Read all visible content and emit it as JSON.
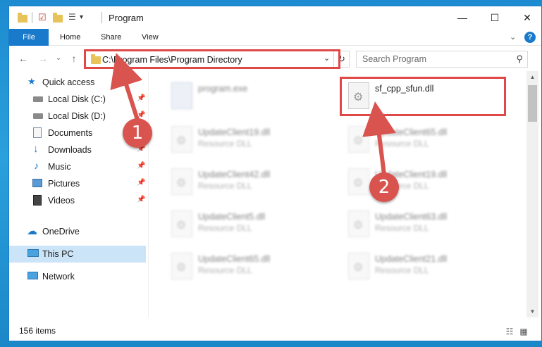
{
  "window": {
    "title": "Program",
    "controls": {
      "minimize": "—",
      "maximize": "☐",
      "close": "✕"
    }
  },
  "ribbon": {
    "tabs": [
      "File",
      "Home",
      "Share",
      "View"
    ],
    "expand": "⌄",
    "help": "?"
  },
  "address": {
    "path": "C:\\Program Files\\Program Directory",
    "refresh": "↻",
    "dropdown": "⌄"
  },
  "search": {
    "placeholder": "Search Program",
    "icon": "⚲"
  },
  "nav": {
    "back": "←",
    "forward": "→",
    "recent": "⌄",
    "up": "↑"
  },
  "sidebar": {
    "items": [
      {
        "label": "Quick access",
        "icon": "star-icon",
        "pinned": false
      },
      {
        "label": "Local Disk (C:)",
        "icon": "drive-icon",
        "pinned": true
      },
      {
        "label": "Local Disk (D:)",
        "icon": "drive-icon",
        "pinned": true
      },
      {
        "label": "Documents",
        "icon": "documents-icon",
        "pinned": true
      },
      {
        "label": "Downloads",
        "icon": "download-icon",
        "pinned": true
      },
      {
        "label": "Music",
        "icon": "music-icon",
        "pinned": true
      },
      {
        "label": "Pictures",
        "icon": "pictures-icon",
        "pinned": true
      },
      {
        "label": "Videos",
        "icon": "videos-icon",
        "pinned": true
      },
      {
        "label": "OneDrive",
        "icon": "cloud-icon",
        "pinned": false
      },
      {
        "label": "This PC",
        "icon": "computer-icon",
        "pinned": false,
        "selected": true
      },
      {
        "label": "Network",
        "icon": "network-icon",
        "pinned": false
      }
    ],
    "pin_glyph": "📌"
  },
  "files": [
    {
      "name": "program.exe",
      "type": "",
      "blurred": true
    },
    {
      "name": "sf_cpp_sfun.dll",
      "type": "",
      "blurred": false,
      "highlighted": true
    },
    {
      "name": "UpdateClient19.dll",
      "type": "Resource DLL",
      "blurred": true
    },
    {
      "name": "UpdateClient65.dll",
      "type": "Resource DLL",
      "blurred": true
    },
    {
      "name": "UpdateClient42.dll",
      "type": "Resource DLL",
      "blurred": true
    },
    {
      "name": "UpdateClient19.dll",
      "type": "Resource DLL",
      "blurred": true
    },
    {
      "name": "UpdateClient5.dll",
      "type": "Resource DLL",
      "blurred": true
    },
    {
      "name": "UpdateClient63.dll",
      "type": "Resource DLL",
      "blurred": true
    },
    {
      "name": "UpdateClient65.dll",
      "type": "Resource DLL",
      "blurred": true
    },
    {
      "name": "UpdateClient21.dll",
      "type": "Resource DLL",
      "blurred": true
    }
  ],
  "status": {
    "item_count": "156 items"
  },
  "callouts": {
    "step1": "1",
    "step2": "2"
  },
  "colors": {
    "accent": "#1979ca",
    "highlight": "#e04848",
    "badge": "#d9534f",
    "selection": "#cce4f7"
  }
}
